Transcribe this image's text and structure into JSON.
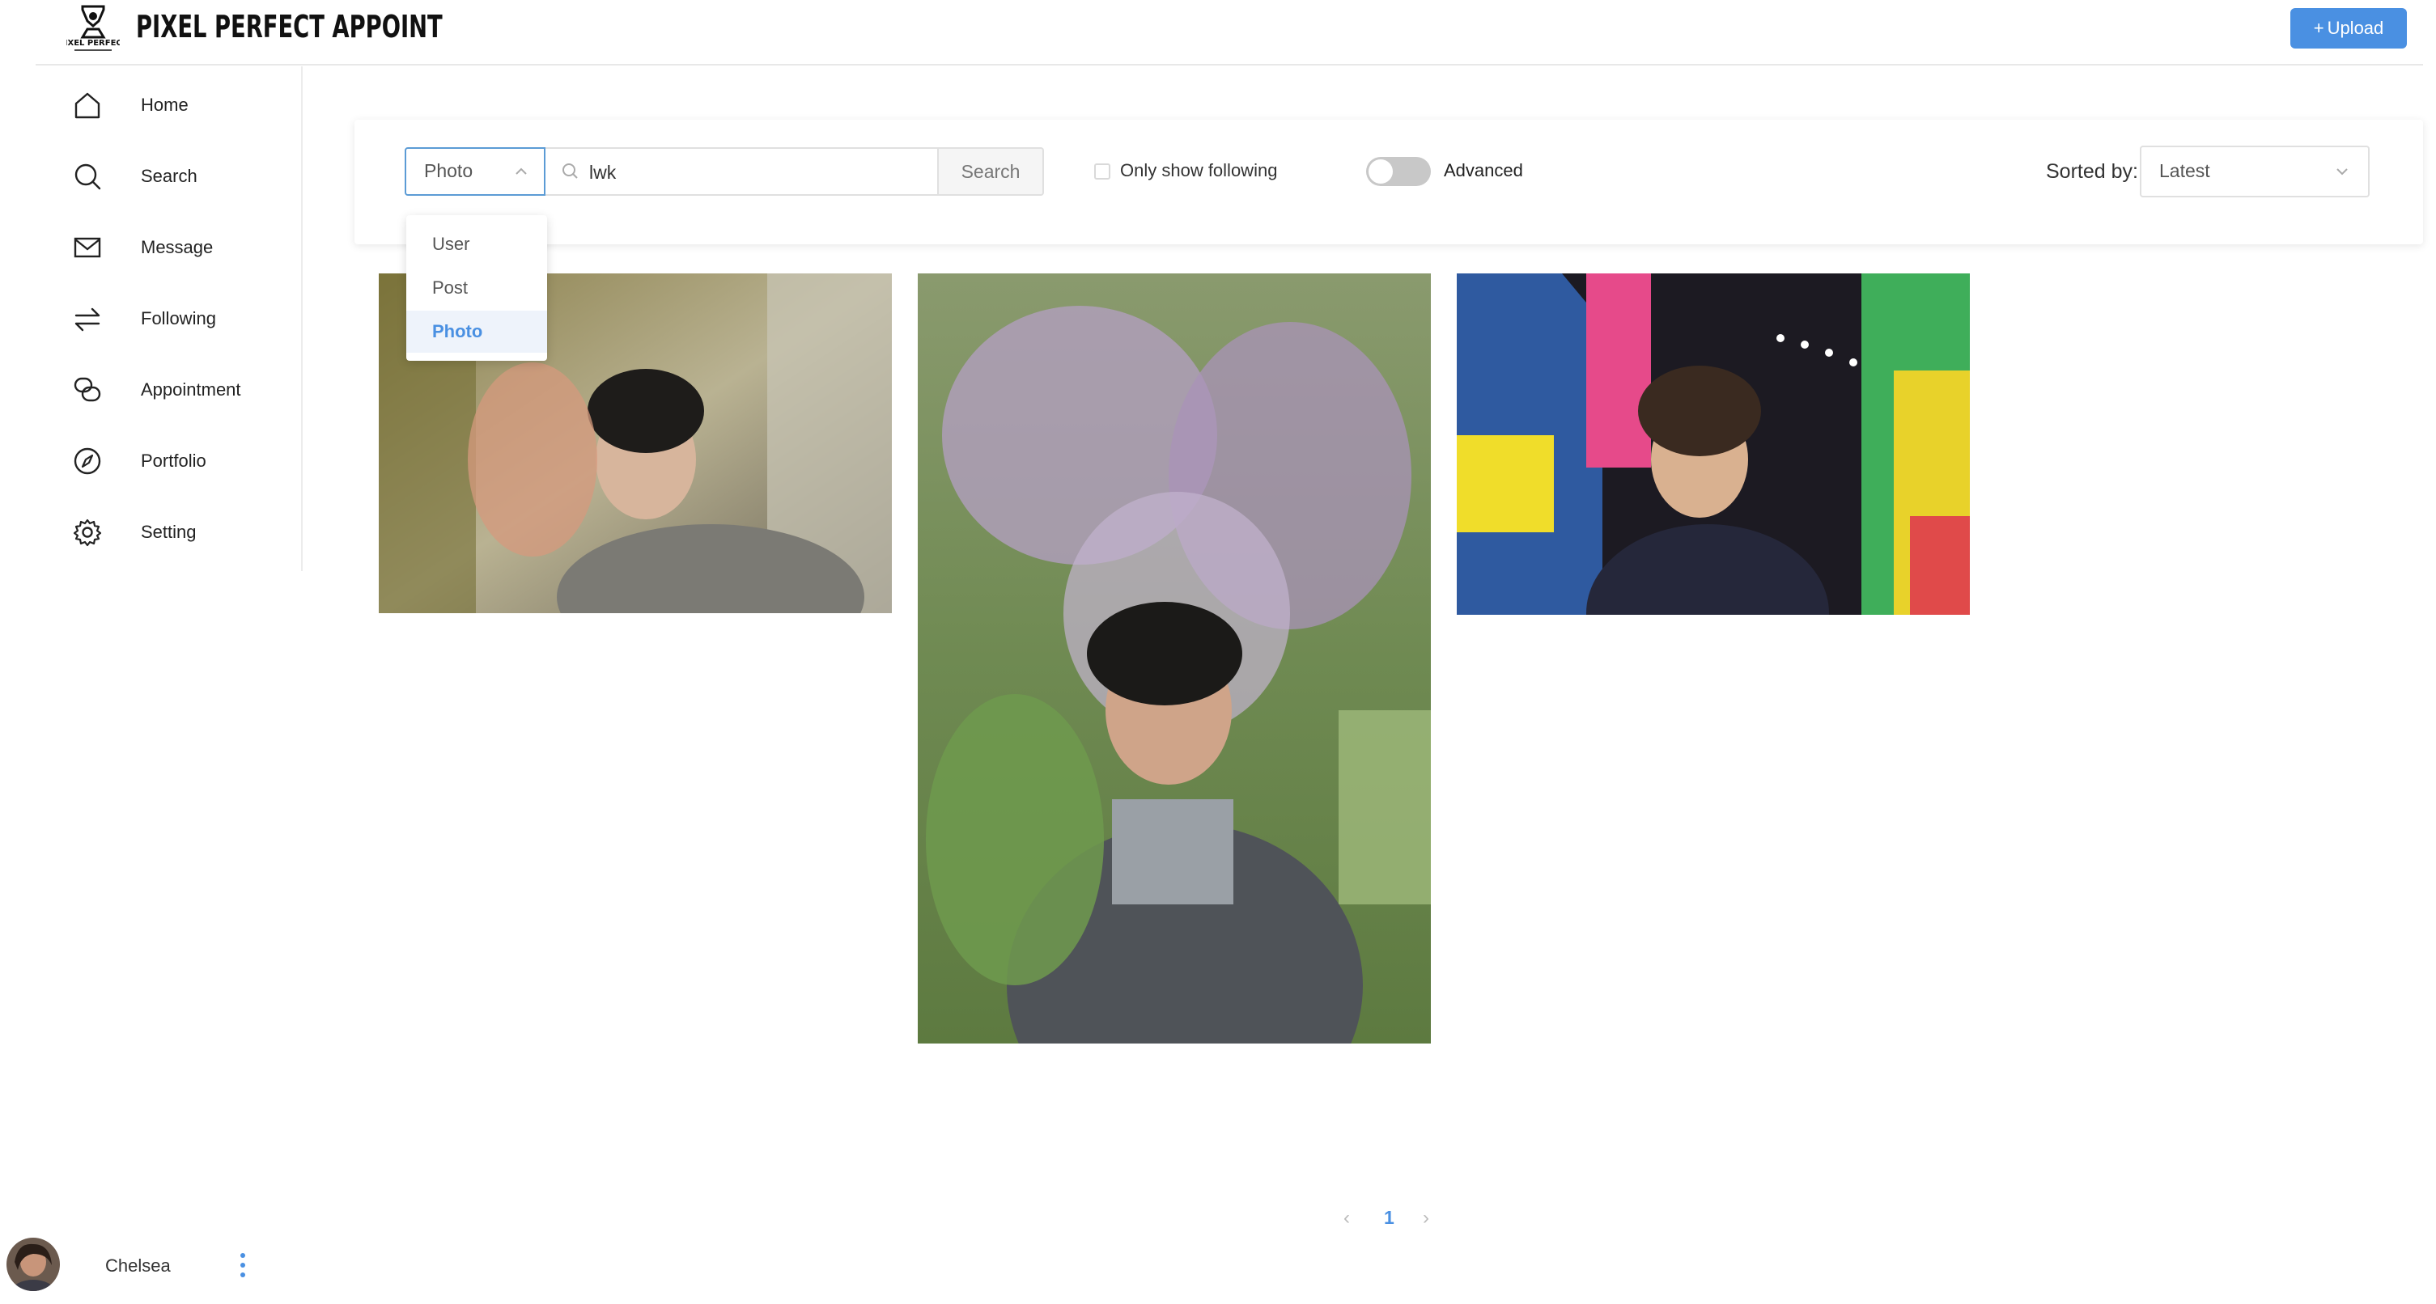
{
  "header": {
    "logo_icon": "hourglass-logo-icon",
    "logo_text": "PIXEL PERFECT",
    "app_title": "PIXEL PERFECT APPOINT",
    "upload_label": "Upload",
    "upload_icon": "plus-icon"
  },
  "sidebar": {
    "items": [
      {
        "label": "Home",
        "icon": "home-icon"
      },
      {
        "label": "Search",
        "icon": "search-icon"
      },
      {
        "label": "Message",
        "icon": "mail-icon"
      },
      {
        "label": "Following",
        "icon": "arrows-icon"
      },
      {
        "label": "Appointment",
        "icon": "chat-bubbles-icon"
      },
      {
        "label": "Portfolio",
        "icon": "compass-icon"
      },
      {
        "label": "Setting",
        "icon": "gear-icon"
      }
    ]
  },
  "search": {
    "type_selected": "Photo",
    "type_options": [
      "User",
      "Post",
      "Photo"
    ],
    "query": "lwk",
    "button_label": "Search",
    "only_following_label": "Only show following",
    "only_following_checked": false,
    "advanced_label": "Advanced",
    "advanced_on": false,
    "sorted_label": "Sorted by:",
    "sort_value": "Latest"
  },
  "photos": [
    {
      "name": "photo-person-waving"
    },
    {
      "name": "photo-person-flowers"
    },
    {
      "name": "photo-person-colorful-wall"
    }
  ],
  "pagination": {
    "current": "1",
    "prev": "‹",
    "next": "›"
  },
  "user": {
    "name": "Chelsea",
    "menu_icon": "vertical-dots-icon"
  },
  "colors": {
    "accent": "#4a90e2",
    "toggle_off": "#c8c8c8"
  }
}
